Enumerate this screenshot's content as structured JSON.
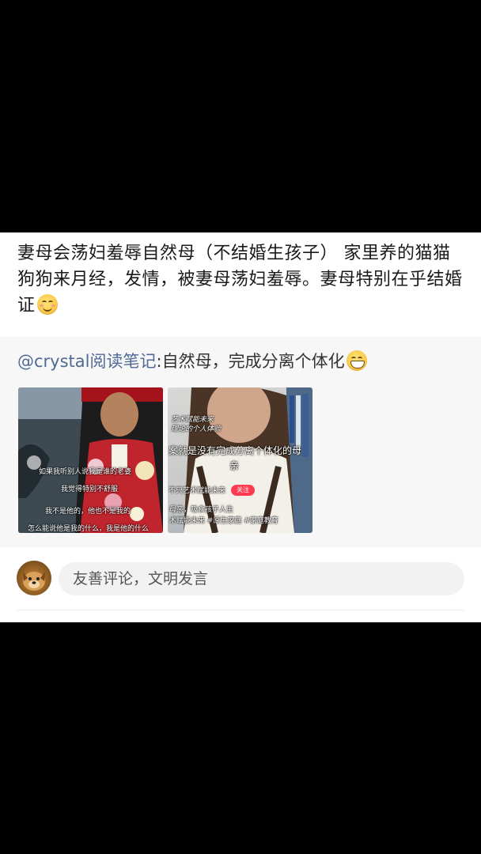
{
  "post": {
    "text": "妻母会荡妇羞辱自然母（不结婚生孩子） 家里养的猫猫狗狗来月经，发情，被妻母荡妇羞辱。妻母特别在乎结婚证",
    "emoji": "smiling-blush-emoji"
  },
  "repost": {
    "mention": "@crystal阅读笔记",
    "text": ":自然母，完成分离个体化",
    "emoji": "grin-emoji",
    "image1_subtitles": [
      "如果我听别人说我是谁的老婆",
      "我觉得特别不舒服",
      "我不是他的，他也不是我的",
      "怎么能说他是我的什么，我是他的什么"
    ],
    "image2_overlay": {
      "top_line1": "艺术赋能未来",
      "top_line2": "理论的个人体验",
      "subtitle_line1": "案就是没有完成分离个体化的母",
      "subtitle_line2": "亲",
      "bottom_line1": "不只艺术赋能未来",
      "follow_badge": "关注",
      "bottom_line2": "母亲，吸食孩子人生",
      "bottom_line3": "术赋能未来 #原生家庭 #家庭教育"
    }
  },
  "comment": {
    "placeholder": "友善评论，文明发言"
  },
  "colors": {
    "mention": "#506a95",
    "follow_badge": "#ff3b4f"
  }
}
